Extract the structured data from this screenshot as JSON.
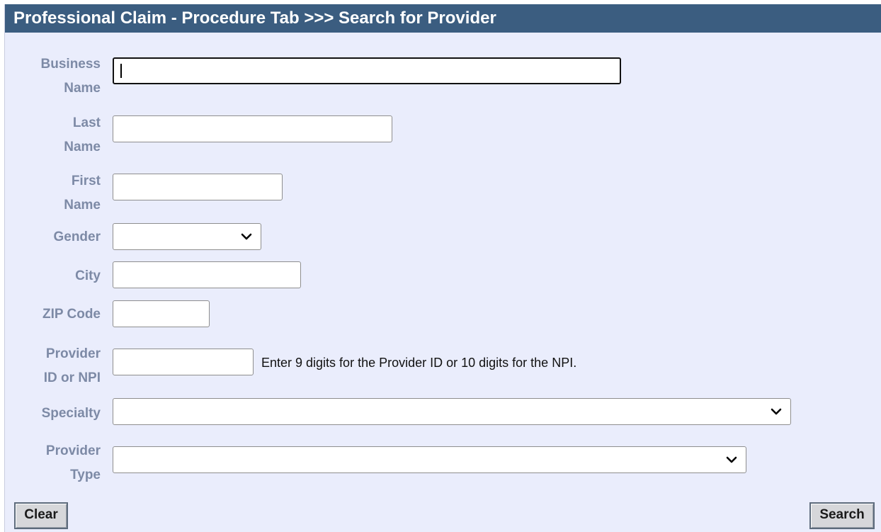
{
  "title": "Professional Claim - Procedure Tab >>> Search for Provider",
  "fields": {
    "business_name": {
      "label_line1": "Business",
      "label_line2": "Name",
      "value": ""
    },
    "last_name": {
      "label_line1": "Last",
      "label_line2": "Name",
      "value": ""
    },
    "first_name": {
      "label_line1": "First",
      "label_line2": "Name",
      "value": ""
    },
    "gender": {
      "label": "Gender",
      "value": ""
    },
    "city": {
      "label": "City",
      "value": ""
    },
    "zip_code": {
      "label": "ZIP Code",
      "value": ""
    },
    "provider_id": {
      "label_line1": "Provider",
      "label_line2": "ID or NPI",
      "value": "",
      "hint": "Enter 9 digits for the Provider ID or 10 digits for the NPI."
    },
    "specialty": {
      "label": "Specialty",
      "value": ""
    },
    "provider_type": {
      "label_line1": "Provider",
      "label_line2": "Type",
      "value": ""
    }
  },
  "buttons": {
    "clear": "Clear",
    "search": "Search"
  },
  "icons": {
    "dropdown": "chevron-down-icon"
  },
  "colors": {
    "title_bar": "#3b5d80",
    "panel_bg": "#eaedfc",
    "label": "#7d8aa6"
  }
}
